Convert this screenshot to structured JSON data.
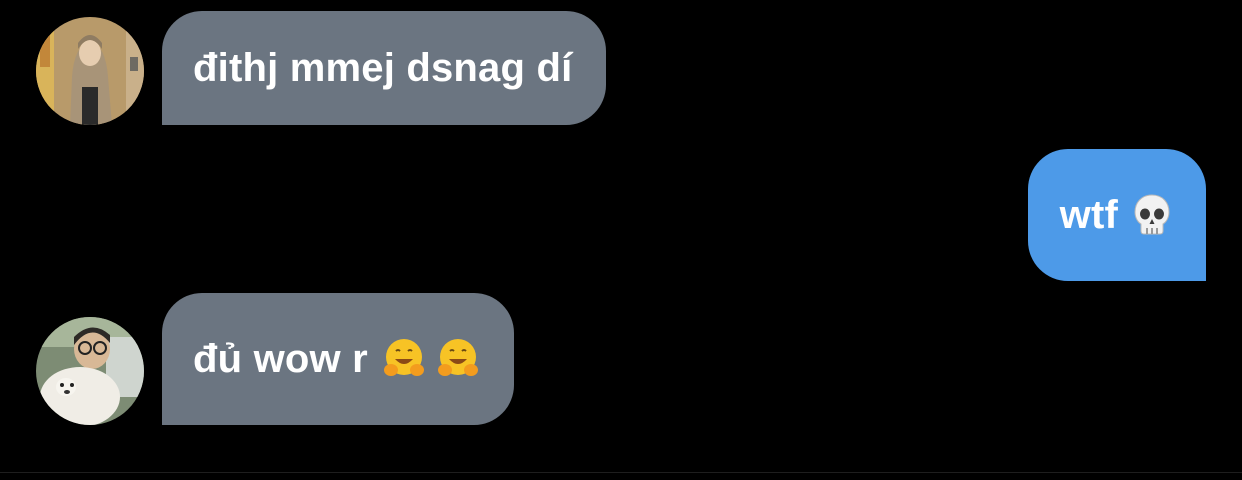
{
  "messages": [
    {
      "direction": "incoming",
      "text": "đithj mmej dsnag dí",
      "emojis": []
    },
    {
      "direction": "outgoing",
      "text": "wtf",
      "emojis": [
        "skull-emoji"
      ]
    },
    {
      "direction": "incoming",
      "text": "đủ wow r",
      "emojis": [
        "hugging-face-emoji",
        "hugging-face-emoji"
      ]
    }
  ],
  "colors": {
    "background": "#000000",
    "incoming_bubble": "#6b7581",
    "outgoing_bubble": "#4d9ae8",
    "text": "#ffffff"
  }
}
